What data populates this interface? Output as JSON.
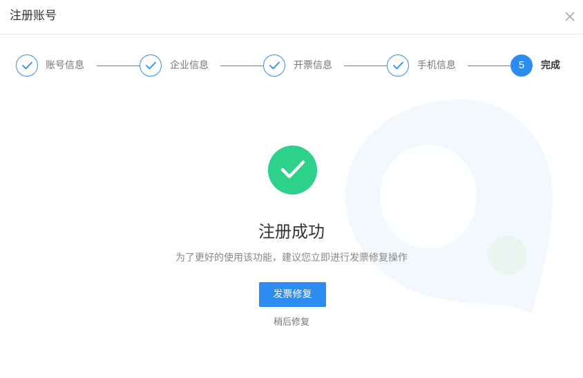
{
  "dialog": {
    "title": "注册账号"
  },
  "steps": [
    {
      "label": "账号信息",
      "status": "done"
    },
    {
      "label": "企业信息",
      "status": "done"
    },
    {
      "label": "开票信息",
      "status": "done"
    },
    {
      "label": "手机信息",
      "status": "done"
    },
    {
      "label": "完成",
      "number": "5",
      "status": "active"
    }
  ],
  "result": {
    "title": "注册成功",
    "description": "为了更好的使用该功能，建议您立即进行发票修复操作",
    "primary_button": "发票修复",
    "secondary_link": "稍后修复"
  },
  "colors": {
    "accent": "#2d8cf0",
    "success": "#2cd18a"
  },
  "icons": {
    "close": "close-icon",
    "step_done": "check-icon",
    "success": "check-icon"
  }
}
